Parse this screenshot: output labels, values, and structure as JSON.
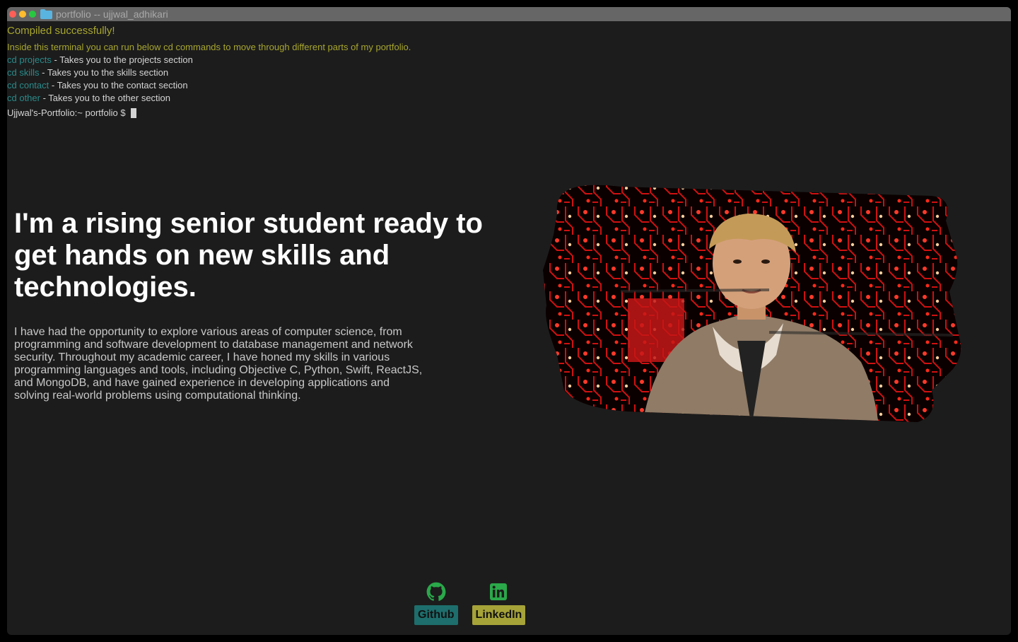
{
  "window": {
    "title": "portfolio -- ujjwal_adhikari"
  },
  "terminal": {
    "status": "Compiled successfully!",
    "intro": "Inside this terminal you can run below cd commands to move through different parts of my portfolio.",
    "commands": [
      {
        "cmd": "cd projects",
        "desc": " - Takes you to the projects section"
      },
      {
        "cmd": "cd skills",
        "desc": " - Takes you to the skills section"
      },
      {
        "cmd": "cd contact",
        "desc": " - Takes you to the contact section"
      },
      {
        "cmd": "cd other",
        "desc": " - Takes you to the other section"
      }
    ],
    "prompt": "Ujjwal's-Portfolio:~ portfolio $"
  },
  "hero": {
    "headline": "I'm a rising senior student ready to get hands on new skills and technologies.",
    "bio": "I have had the opportunity to explore various areas of computer science, from programming and software development to database management and network security. Throughout my academic career, I have honed my skills in various programming languages and tools, including Objective C, Python, Swift, ReactJS, and MongoDB, and have gained experience in developing applications and solving real-world problems using computational thinking."
  },
  "links": {
    "github_label": "Github",
    "linkedin_label": "LinkedIn",
    "github_icon": "github-icon",
    "linkedin_icon": "linkedin-icon"
  },
  "colors": {
    "accent_yellow": "#a7a62f",
    "command_teal": "#2b8a8a",
    "github_button": "#1d6e6c",
    "linkedin_button": "#a6a339",
    "icon_green": "#2aa84a"
  }
}
